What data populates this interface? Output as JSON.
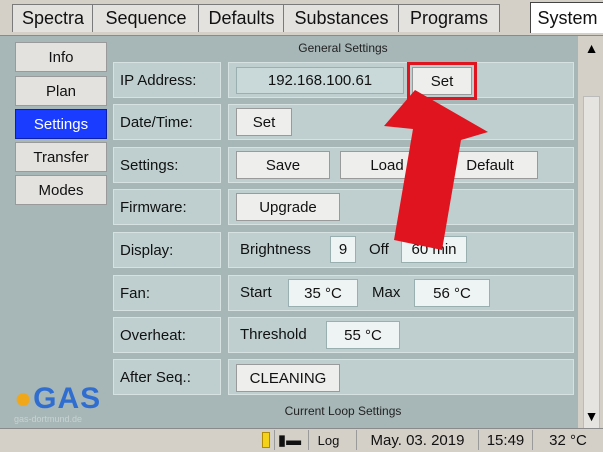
{
  "tabs": [
    "Spectra",
    "Sequence",
    "Defaults",
    "Substances",
    "Programs",
    "System"
  ],
  "nav": [
    "Info",
    "Plan",
    "Settings",
    "Transfer",
    "Modes"
  ],
  "logo": {
    "text": "GAS",
    "sub": "gas-dortmund.de"
  },
  "general_title": "General Settings",
  "current_loop_title": "Current Loop Settings",
  "rows": {
    "ip": {
      "label": "IP Address:",
      "value": "192.168.100.61",
      "button": "Set"
    },
    "datetime": {
      "label": "Date/Time:",
      "button": "Set"
    },
    "settings": {
      "label": "Settings:",
      "save": "Save",
      "load": "Load",
      "default": "Default"
    },
    "firmware": {
      "label": "Firmware:",
      "button": "Upgrade"
    },
    "display": {
      "label": "Display:",
      "brightness_label": "Brightness",
      "brightness_value": "9",
      "off_label": "Off",
      "off_value": "60 min"
    },
    "fan": {
      "label": "Fan:",
      "start_label": "Start",
      "start_value": "35 °C",
      "max_label": "Max",
      "max_value": "56 °C"
    },
    "overheat": {
      "label": "Overheat:",
      "threshold_label": "Threshold",
      "threshold_value": "55 °C"
    },
    "afterseq": {
      "label": "After Seq.:",
      "value": "CLEANING"
    }
  },
  "status": {
    "log": "Log",
    "date": "May. 03. 2019",
    "time": "15:49",
    "temp": "32 °C"
  },
  "colors": {
    "panel": "#a7b6b6",
    "selected": "#1a3cff",
    "highlight": "#e0141e",
    "arrow": "#e0141e"
  }
}
